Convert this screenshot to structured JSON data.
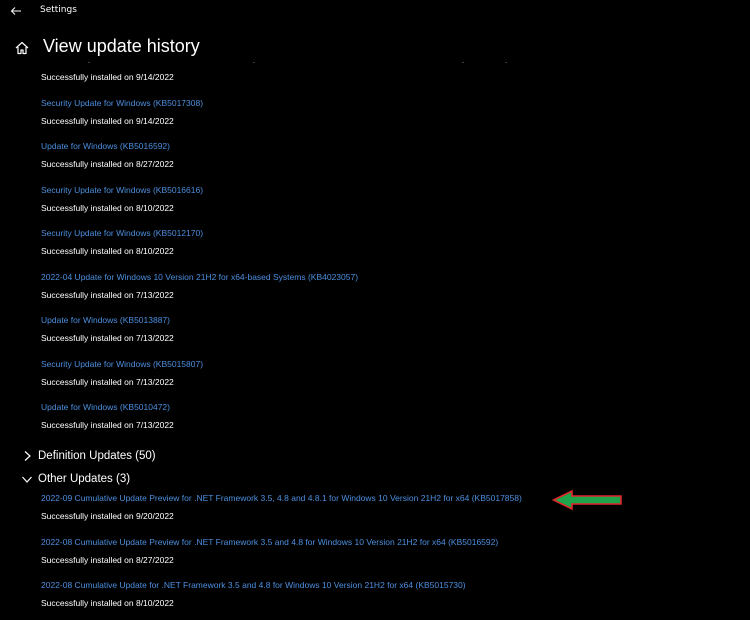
{
  "app": {
    "title": "Settings"
  },
  "page": {
    "title": "View update history"
  },
  "top_status": "Successfully installed on 9/14/2022",
  "quality_updates": [
    {
      "name": "Security Update for Windows (KB5017308)",
      "status": "Successfully installed on 9/14/2022"
    },
    {
      "name": "Update for Windows (KB5016592)",
      "status": "Successfully installed on 8/27/2022"
    },
    {
      "name": "Security Update for Windows (KB5016616)",
      "status": "Successfully installed on 8/10/2022"
    },
    {
      "name": "Security Update for Windows (KB5012170)",
      "status": "Successfully installed on 8/10/2022"
    },
    {
      "name": "2022-04 Update for Windows 10 Version 21H2 for x64-based Systems (KB4023057)",
      "status": "Successfully installed on 7/13/2022"
    },
    {
      "name": "Update for Windows (KB5013887)",
      "status": "Successfully installed on 7/13/2022"
    },
    {
      "name": "Security Update for Windows (KB5015807)",
      "status": "Successfully installed on 7/13/2022"
    },
    {
      "name": "Update for Windows (KB5010472)",
      "status": "Successfully installed on 7/13/2022"
    }
  ],
  "definition_updates": {
    "label": "Definition Updates (50)",
    "icon": "chevron-right-icon"
  },
  "other_updates": {
    "label": "Other Updates (3)",
    "icon": "chevron-down-icon",
    "items": [
      {
        "name": "2022-09 Cumulative Update Preview for .NET Framework 3.5, 4.8 and 4.8.1 for Windows 10 Version 21H2 for x64 (KB5017858)",
        "status": "Successfully installed on 9/20/2022"
      },
      {
        "name": "2022-08 Cumulative Update Preview for .NET Framework 3.5 and 4.8 for Windows 10 Version 21H2 for x64 (KB5016592)",
        "status": "Successfully installed on 8/27/2022"
      },
      {
        "name": "2022-08 Cumulative Update for .NET Framework 3.5 and 4.8 for Windows 10 Version 21H2 for x64 (KB5015730)",
        "status": "Successfully installed on 8/10/2022"
      }
    ]
  },
  "colors": {
    "background": "#000000",
    "link": "#4c8fdf",
    "text": "#ffffff",
    "annotation_arrow_fill": "#1fa34a",
    "annotation_arrow_border": "#e0242b"
  }
}
